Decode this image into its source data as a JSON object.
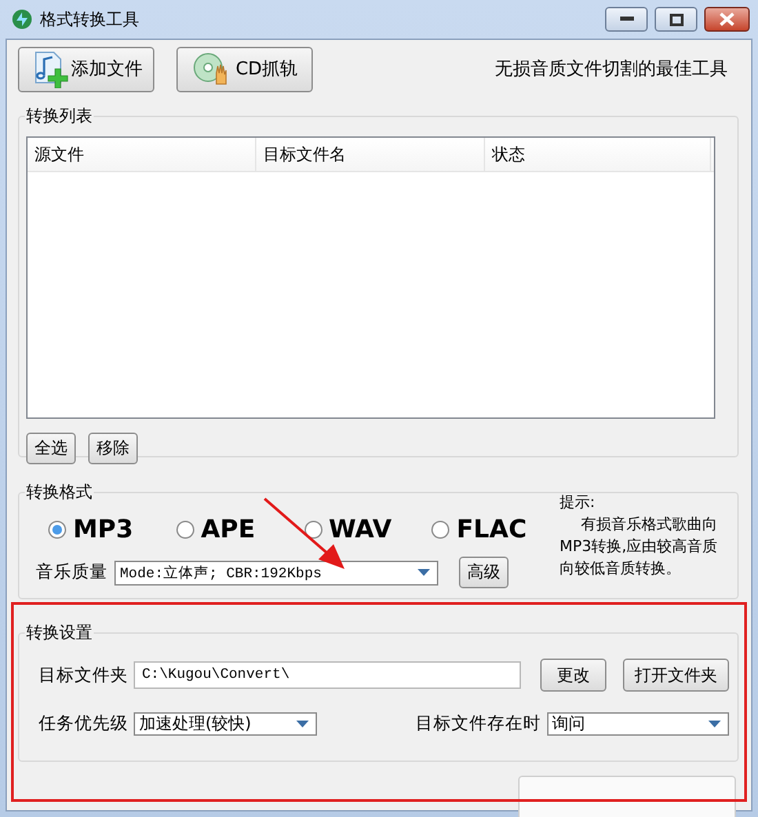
{
  "window": {
    "title": "格式转换工具"
  },
  "toolbar": {
    "buttons": [
      {
        "label": "添加文件",
        "kind": "add"
      },
      {
        "label": "CD抓轨",
        "kind": "cd"
      }
    ],
    "tagline": "无损音质文件切割的最佳工具"
  },
  "list_group": {
    "title": "转换列表",
    "columns": [
      "源文件",
      "目标文件名",
      "状态"
    ],
    "buttons": [
      "全选",
      "移除"
    ]
  },
  "format_group": {
    "title": "转换格式",
    "formats": [
      {
        "label": "MP3",
        "selected": true
      },
      {
        "label": "APE",
        "selected": false
      },
      {
        "label": "WAV",
        "selected": false
      },
      {
        "label": "FLAC",
        "selected": false
      }
    ],
    "quality_label": "音乐质量",
    "quality_value": "Mode:立体声; CBR:192Kbps",
    "advanced_button": "高级",
    "hint_title": "提示:",
    "hint_text": "有损音乐格式歌曲向MP3转换,应由较高音质向较低音质转换。"
  },
  "settings_group": {
    "title": "转换设置",
    "folder_label": "目标文件夹",
    "folder_value": "C:\\Kugou\\Convert\\",
    "change_button": "更改",
    "open_button": "打开文件夹",
    "priority_label": "任务优先级",
    "priority_value": "加速处理(较快)",
    "exists_label": "目标文件存在时",
    "exists_value": "询问"
  }
}
